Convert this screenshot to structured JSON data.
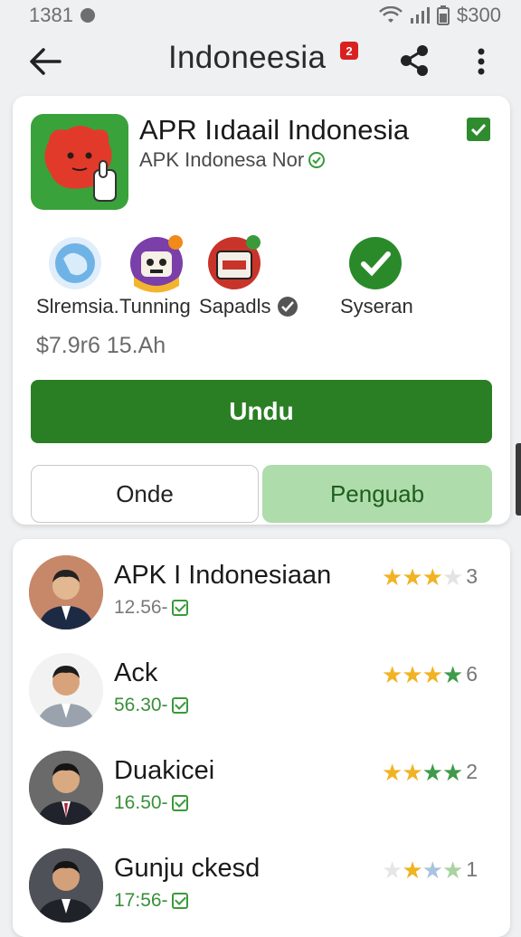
{
  "status_bar": {
    "time": "1381",
    "right_text": "$300"
  },
  "header": {
    "title": "Indoneesia",
    "badge": "2"
  },
  "app": {
    "name": "APR Iıdaail Indonesia",
    "subtitle": "APK Indonesa Nor",
    "features": [
      {
        "label": "Slremsia."
      },
      {
        "label": "Tunning"
      },
      {
        "label": "Sapadls"
      },
      {
        "label": "Syseran"
      }
    ],
    "price": "$7.9r6 15.Ah",
    "primary_button": "Undu",
    "secondary_button_left": "Onde",
    "secondary_button_right": "Penguab"
  },
  "reviews": [
    {
      "name": "APK I Indonesiaan",
      "meta": "12.56-",
      "meta_color": "gray",
      "count": "3",
      "stars": [
        "#f0b323",
        "#f0b323",
        "#f0b323",
        "#e3e3e3"
      ]
    },
    {
      "name": "Ack",
      "meta": "56.30-",
      "meta_color": "green",
      "count": "6",
      "stars": [
        "#f0b323",
        "#f0b323",
        "#f0b323",
        "#3f9a4a"
      ]
    },
    {
      "name": "Duakicei",
      "meta": "16.50-",
      "meta_color": "green",
      "count": "2",
      "stars": [
        "#f0b323",
        "#f0b323",
        "#3f9a4a",
        "#3f9a4a"
      ]
    },
    {
      "name": "Gunju ckesd",
      "meta": "17:56-",
      "meta_color": "green",
      "count": "1",
      "stars": [
        "#e6e6e6",
        "#f0b323",
        "#a9c4e0",
        "#a9d3a0"
      ]
    }
  ]
}
